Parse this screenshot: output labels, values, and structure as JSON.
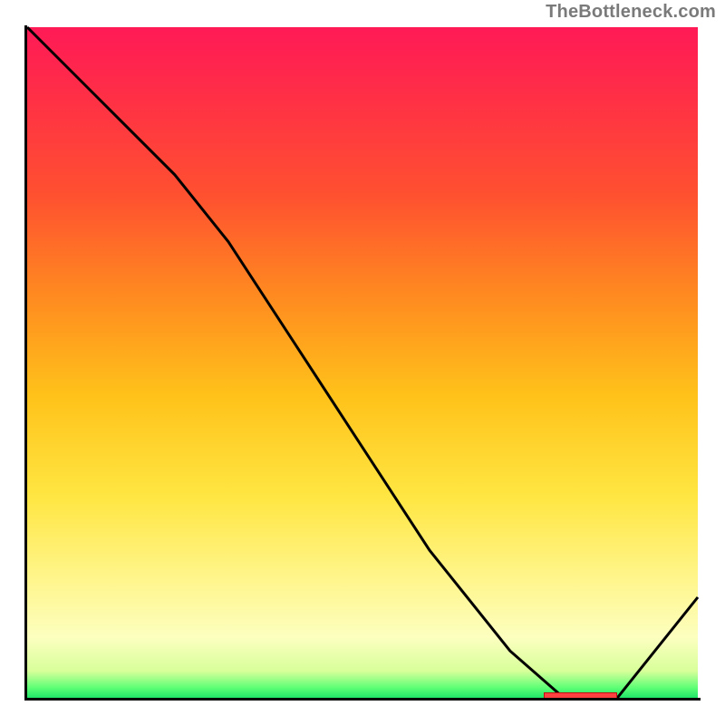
{
  "attribution": "TheBottleneck.com",
  "colors": {
    "line": "#000000",
    "marker": "#ff4040",
    "axis": "#000000"
  },
  "chart_data": {
    "type": "line",
    "title": "",
    "xlabel": "",
    "ylabel": "",
    "xlim": [
      0,
      100
    ],
    "ylim": [
      0,
      100
    ],
    "grid": false,
    "legend": false,
    "series": [
      {
        "name": "curve",
        "x": [
          0,
          10,
          22,
          30,
          45,
          60,
          72,
          80,
          88,
          100
        ],
        "values": [
          100,
          90,
          78,
          68,
          45,
          22,
          7,
          0,
          0,
          15
        ]
      }
    ],
    "annotations": [
      {
        "type": "marker-bar",
        "x_start": 77,
        "x_end": 88,
        "y": 0
      }
    ],
    "background": {
      "type": "vertical-gradient",
      "stops": [
        {
          "pos": 0.0,
          "color": "#ff1a56"
        },
        {
          "pos": 0.55,
          "color": "#ffc21a"
        },
        {
          "pos": 0.9,
          "color": "#fcffbf"
        },
        {
          "pos": 1.0,
          "color": "#20e56a"
        }
      ]
    }
  }
}
